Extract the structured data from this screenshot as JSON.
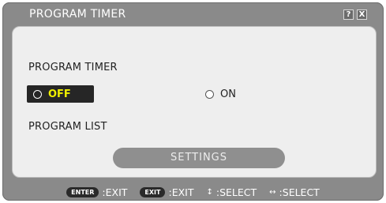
{
  "window": {
    "title": "PROGRAM TIMER",
    "help_icon": "?",
    "close_icon": "X"
  },
  "panel": {
    "section_label": "PROGRAM TIMER",
    "options": [
      {
        "label": "OFF",
        "selected": true
      },
      {
        "label": "ON",
        "selected": false
      }
    ],
    "list_label": "PROGRAM LIST",
    "settings_button": "SETTINGS"
  },
  "footer": {
    "hints": [
      {
        "key": "ENTER",
        "action": ":EXIT"
      },
      {
        "key": "EXIT",
        "action": ":EXIT"
      },
      {
        "icon": "up-down-arrows-icon",
        "glyph": "↕",
        "action": ":SELECT"
      },
      {
        "icon": "left-right-arrows-icon",
        "glyph": "↔",
        "action": ":SELECT"
      }
    ]
  },
  "colors": {
    "window_bg": "#8a8a8a",
    "panel_bg": "#eeeeee",
    "highlight_bg": "#262626",
    "highlight_text": "#f0f000",
    "button_bg": "#8f8f8f"
  }
}
